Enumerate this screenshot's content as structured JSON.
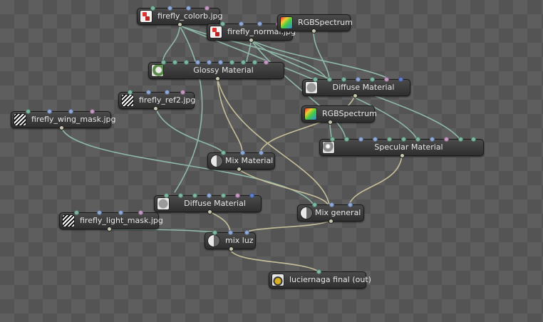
{
  "graph": {
    "nodes": {
      "firefly_colorb": {
        "label": "firefly_colorb.jpg",
        "icon": "image-texture-icon"
      },
      "firefly_normal": {
        "label": "firefly_normal.jpg",
        "icon": "image-texture-icon"
      },
      "rgb_spectrum_1": {
        "label": "RGBSpectrum",
        "icon": "rgb-spectrum-icon"
      },
      "glossy_material": {
        "label": "Glossy Material",
        "icon": "glossy-material-icon"
      },
      "diffuse_material_1": {
        "label": "Diffuse Material",
        "icon": "diffuse-material-icon"
      },
      "firefly_ref2": {
        "label": "firefly_ref2.jpg",
        "icon": "float-texture-icon"
      },
      "rgb_spectrum_2": {
        "label": "RGBSpectrum",
        "icon": "rgb-spectrum-icon"
      },
      "firefly_wing_mask": {
        "label": "firefly_wing_mask.jpg",
        "icon": "float-texture-icon"
      },
      "specular_material": {
        "label": "Specular Material",
        "icon": "specular-material-icon"
      },
      "mix_material": {
        "label": "Mix Material",
        "icon": "mix-material-icon"
      },
      "diffuse_material_2": {
        "label": "Diffuse Material",
        "icon": "diffuse-material-icon"
      },
      "mix_general": {
        "label": "Mix general",
        "icon": "mix-material-icon"
      },
      "firefly_light_mask": {
        "label": "firefly_light_mask.jpg",
        "icon": "float-texture-icon"
      },
      "mix_luz": {
        "label": "mix luz",
        "icon": "mix-material-icon"
      },
      "luciernaga_final": {
        "label": "luciernaga final (out)",
        "icon": "output-icon"
      }
    },
    "colors": {
      "texture_wire": "#8fb9a8",
      "material_wire": "#c8c09a",
      "socket_green": "#7fb8a0",
      "socket_blue": "#8fa9d8",
      "socket_purple": "#c69ac4",
      "socket_darkblue": "#5d7fcf"
    }
  }
}
